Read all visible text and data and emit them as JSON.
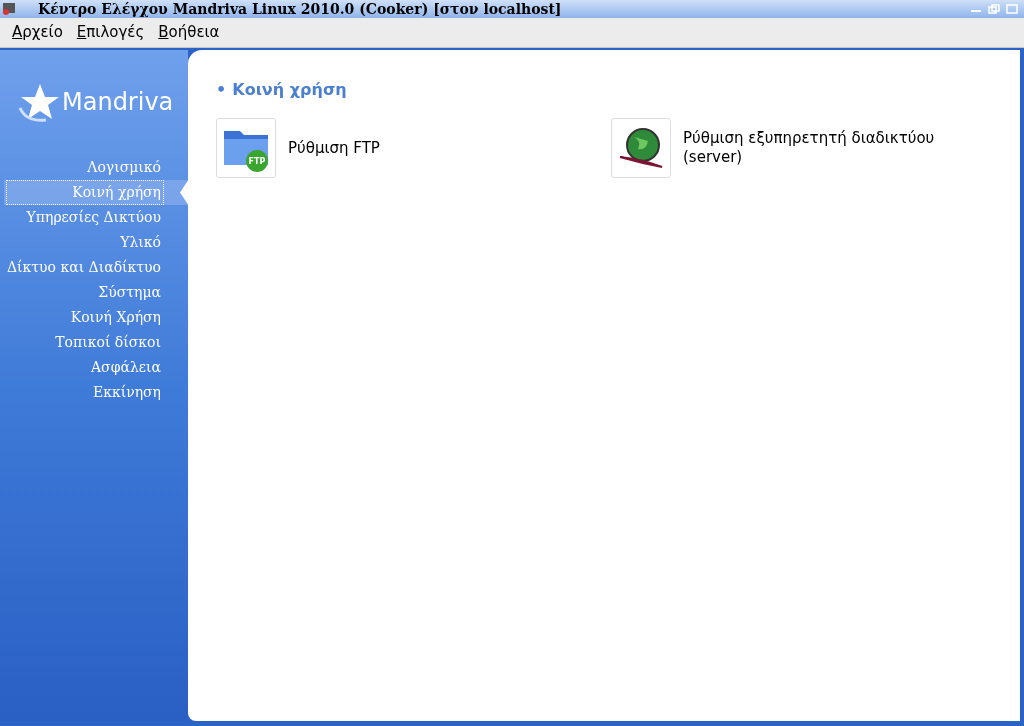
{
  "window": {
    "title": "Κέντρο Ελέγχου Mandriva Linux 2010.0 (Cooker) [στον localhost]"
  },
  "menu": [
    {
      "mnemonic": "Α",
      "rest": "ρχείο"
    },
    {
      "mnemonic": "Ε",
      "rest": "πιλογές"
    },
    {
      "mnemonic": "Β",
      "rest": "οήθεια"
    }
  ],
  "sidebar": {
    "logo": "Mandriva",
    "items": [
      {
        "label": "Λογισμικό",
        "selected": false
      },
      {
        "label": "Κοινή χρήση",
        "selected": true
      },
      {
        "label": "Υπηρεσίες Δικτύου",
        "selected": false
      },
      {
        "label": "Υλικό",
        "selected": false
      },
      {
        "label": "Δίκτυο και Διαδίκτυο",
        "selected": false
      },
      {
        "label": "Σύστημα",
        "selected": false
      },
      {
        "label": "Κοινή Χρήση",
        "selected": false
      },
      {
        "label": "Τοπικοί δίσκοι",
        "selected": false
      },
      {
        "label": "Ασφάλεια",
        "selected": false
      },
      {
        "label": "Εκκίνηση",
        "selected": false
      }
    ]
  },
  "section": {
    "bullet": "•",
    "title": "Κοινή χρήση",
    "tools": [
      {
        "kind": "ftp",
        "label": "Ρύθμιση FTP",
        "badge": "FTP"
      },
      {
        "kind": "web",
        "label": "Ρύθμιση εξυπηρετητή διαδικτύου (server)"
      }
    ]
  }
}
